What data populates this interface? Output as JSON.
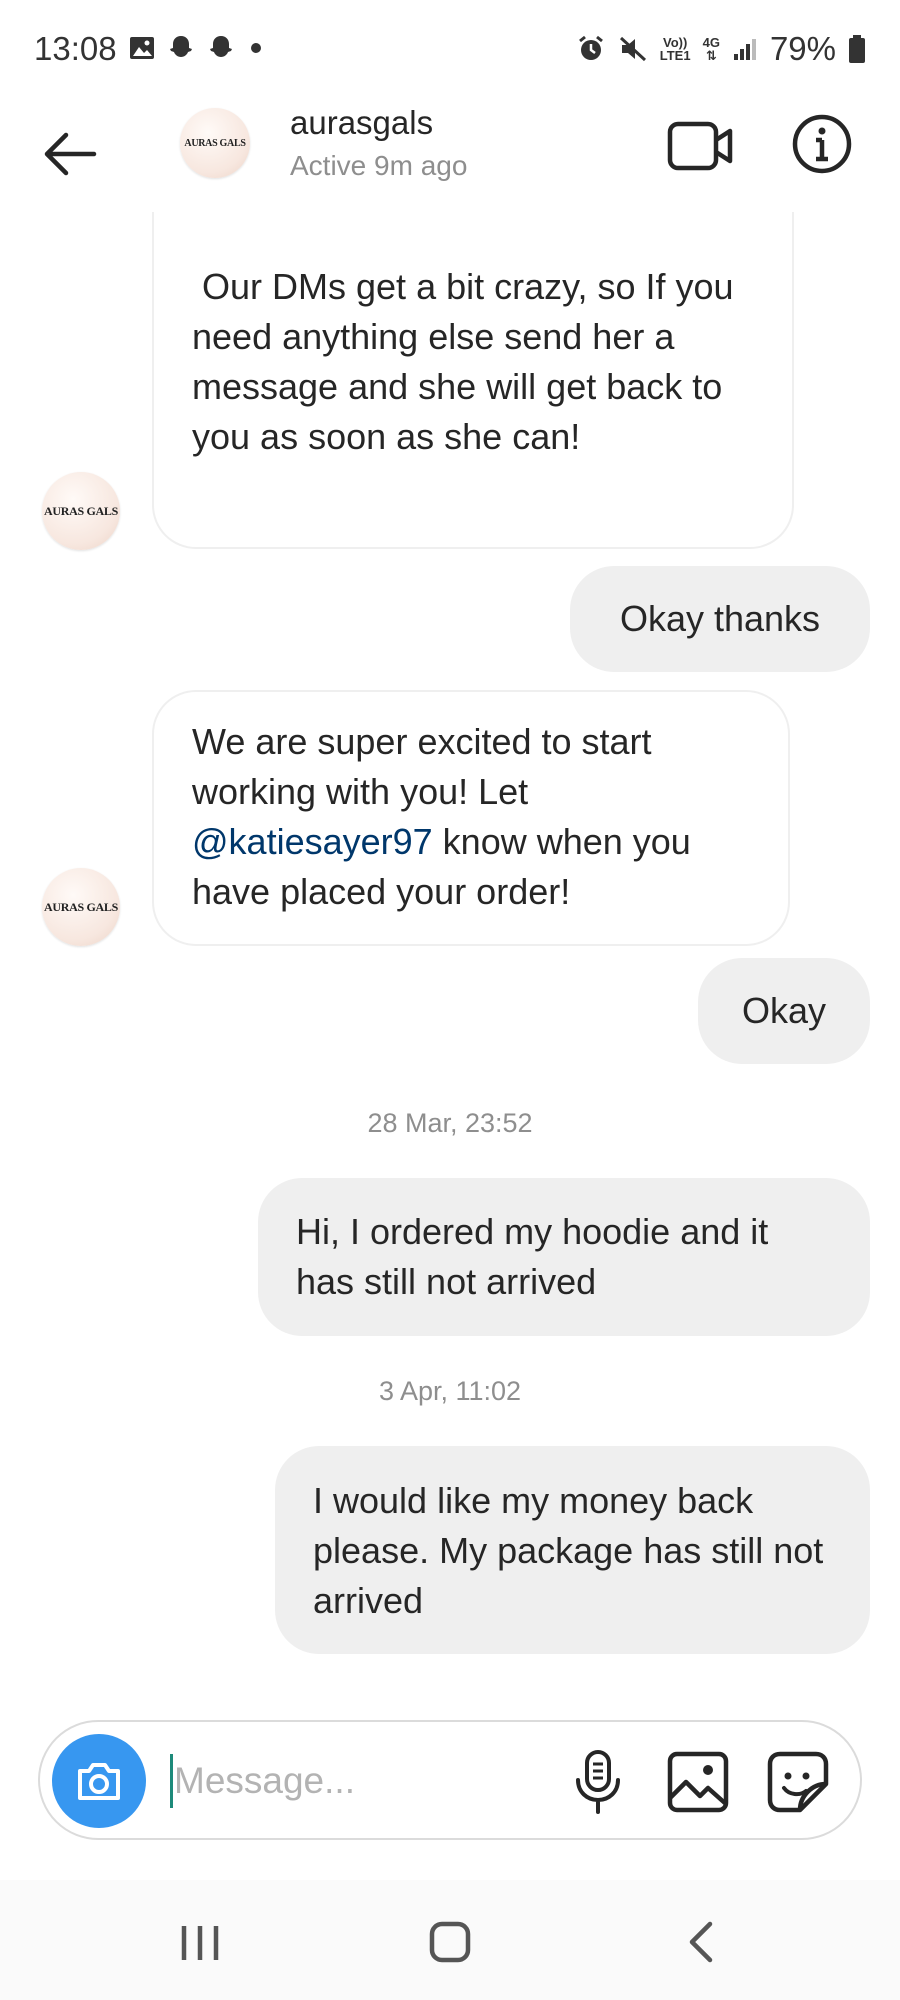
{
  "status_bar": {
    "time": "13:08",
    "battery_percent": "79%",
    "network_type": "4G",
    "volte_label": "Vo))",
    "lte_label": "LTE1",
    "left_icons": [
      "gallery-icon",
      "snapchat-icon",
      "snapchat-icon",
      "dot-icon"
    ],
    "right_icons": [
      "alarm-icon",
      "mute-icon",
      "volte-icon",
      "4g-icon",
      "signal-icon",
      "battery-icon"
    ]
  },
  "header": {
    "name": "aurasgals",
    "status": "Active 9m ago",
    "avatar_text": "AURAS GALS",
    "icons": [
      "back-arrow-icon",
      "video-call-icon",
      "info-icon"
    ]
  },
  "messages": {
    "m1": {
      "sender": "them",
      "text": " Our DMs get a bit crazy, so If you need anything else send her a message and she will get back to you as soon as she can!"
    },
    "m2": {
      "sender": "me",
      "text": "Okay thanks"
    },
    "m3": {
      "sender": "them",
      "text_before": "We are super excited to start working with you! Let ",
      "mention": "@katiesayer97",
      "text_after": " know when you have placed your order!"
    },
    "m4": {
      "sender": "me",
      "text": "Okay"
    },
    "ts1": "28 Mar, 23:52",
    "m5": {
      "sender": "me",
      "text": "Hi, I ordered my hoodie and it has still not arrived"
    },
    "ts2": "3 Apr, 11:02",
    "m6": {
      "sender": "me",
      "text": "I would like my money back please. My package has still not arrived"
    }
  },
  "composer": {
    "placeholder": "Message...",
    "value": "",
    "icons": [
      "camera-icon",
      "microphone-icon",
      "gallery-icon",
      "sticker-icon"
    ]
  },
  "nav_bar": {
    "icons": [
      "recent-apps-icon",
      "home-icon",
      "back-icon"
    ]
  },
  "colors": {
    "accent_blue": "#3797f0",
    "mention_blue": "#00376b",
    "outgoing_bubble": "#efefef",
    "muted_text": "#8e8e8e"
  }
}
